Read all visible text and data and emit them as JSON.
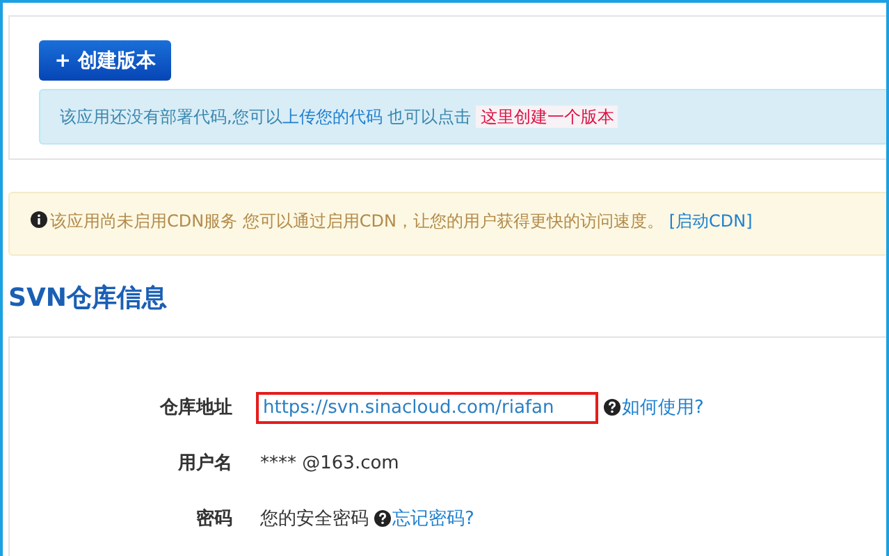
{
  "create_button": {
    "label": "+ 创建版本"
  },
  "deploy_notice": {
    "text": "该应用还没有部署代码,您可以",
    "upload_link": "上传您的代码",
    "text_2": " 也可以点击 ",
    "create_link": "这里创建一个版本"
  },
  "cdn_notice": {
    "text": "该应用尚未启用CDN服务 您可以通过启用CDN，让您的用户获得更快的访问速度。",
    "link": "[启动CDN]"
  },
  "svn": {
    "title": "SVN仓库信息",
    "fields": [
      {
        "kind": "url",
        "label": "仓库地址",
        "value": "https://svn.sinacloud.com/riafan",
        "help_link": "如何使用?"
      },
      {
        "kind": "text",
        "label": "用户名",
        "value": "**** @163.com"
      },
      {
        "kind": "text",
        "label": "密码",
        "value": "您的安全密码",
        "help_link": "忘记密码?"
      }
    ]
  }
}
